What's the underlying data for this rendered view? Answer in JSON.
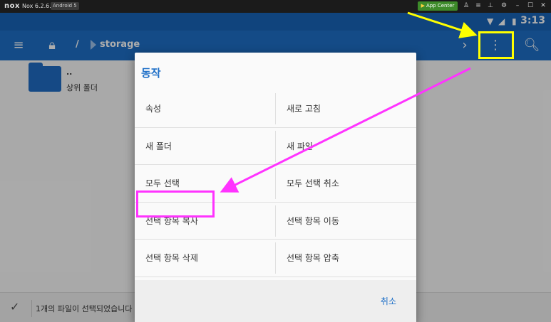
{
  "emulator": {
    "logo": "nox",
    "version": "Nox 6.2.6.3",
    "android_badge": "Android 5",
    "app_center_label": "App Center"
  },
  "status_bar": {
    "time": "3:13",
    "icons": [
      "wifi-icon",
      "signal-icon",
      "battery-icon"
    ]
  },
  "app_bar": {
    "path_root": "/",
    "path_segment": "storage",
    "icons": [
      "menu-icon",
      "lock-icon",
      "chevron-right-icon",
      "overflow-menu-icon",
      "search-icon"
    ]
  },
  "file_list": [
    {
      "name": "..",
      "description": "상위 폴더"
    }
  ],
  "bottom_bar": {
    "text": "1개의 파일이 선택되었습니다"
  },
  "dialog": {
    "title": "동작",
    "actions": [
      {
        "left": "속성",
        "right": "새로 고침"
      },
      {
        "left": "새 폴더",
        "right": "새 파일"
      },
      {
        "left": "모두 선택",
        "right": "모두 선택 취소"
      },
      {
        "left": "선택 항목 복사",
        "right": "선택 항목 이동"
      },
      {
        "left": "선택 항목 삭제",
        "right": "선택 항목 압축"
      }
    ],
    "cancel_label": "취소"
  },
  "annotations": {
    "yellow_color": "#ffff00",
    "magenta_color": "#ff33ff"
  }
}
